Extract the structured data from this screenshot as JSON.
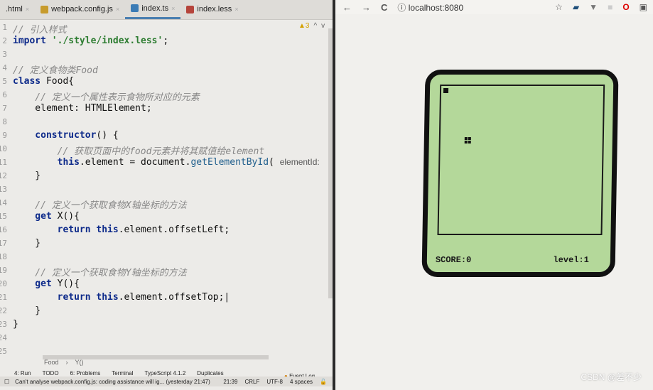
{
  "ide": {
    "tabs": [
      {
        "label": ".html",
        "active": false
      },
      {
        "label": "webpack.config.js",
        "active": false,
        "icon_color": "#c79b2c"
      },
      {
        "label": "index.ts",
        "active": true,
        "icon_color": "#3b7bb5"
      },
      {
        "label": "index.less",
        "active": false,
        "icon_color": "#b5443b"
      }
    ],
    "warnings": {
      "count": "3",
      "up": "^",
      "down": "v"
    },
    "lines": [
      [
        [
          "cm",
          "// 引入样式"
        ]
      ],
      [
        [
          "kw",
          "import "
        ],
        [
          "str",
          "'./style/index.less'"
        ],
        [
          "",
          "; "
        ]
      ],
      [],
      [
        [
          "cm",
          "// 定义食物类Food"
        ]
      ],
      [
        [
          "kw",
          "class "
        ],
        [
          "",
          "Food{"
        ]
      ],
      [
        [
          "cm",
          "    // 定义一个属性表示食物所对应的元素"
        ]
      ],
      [
        [
          "",
          "    element: HTMLElement;"
        ]
      ],
      [],
      [
        [
          "kw",
          "    constructor"
        ],
        [
          "",
          "() {"
        ]
      ],
      [
        [
          "cm",
          "        // 获取页面中的food元素并将其赋值给element"
        ]
      ],
      [
        [
          "kw",
          "        this"
        ],
        [
          "",
          ".element = document."
        ],
        [
          "fn",
          "getElementById"
        ],
        [
          "",
          "( "
        ],
        [
          "hint",
          "elementId:"
        ]
      ],
      [
        [
          "",
          "    }"
        ]
      ],
      [],
      [
        [
          "cm",
          "    // 定义一个获取食物X轴坐标的方法"
        ]
      ],
      [
        [
          "kw",
          "    get "
        ],
        [
          "",
          "X(){"
        ]
      ],
      [
        [
          "kw",
          "        return this"
        ],
        [
          "",
          ".element.offsetLeft;"
        ]
      ],
      [
        [
          "",
          "    }"
        ]
      ],
      [],
      [
        [
          "cm",
          "    // 定义一个获取食物Y轴坐标的方法"
        ]
      ],
      [
        [
          "kw",
          "    get "
        ],
        [
          "",
          "Y(){"
        ]
      ],
      [
        [
          "kw",
          "        return this"
        ],
        [
          "",
          ".element.offsetTop;|"
        ]
      ],
      [
        [
          "",
          "    }"
        ]
      ],
      [
        [
          "",
          "}"
        ]
      ],
      [],
      []
    ],
    "breadcrumb": [
      "Food",
      "Y()"
    ],
    "toolwindows": [
      "4: Run",
      "TODO",
      "6: Problems",
      "Terminal",
      "TypeScript 4.1.2",
      "Duplicates"
    ],
    "event_log": "Event Log",
    "status": {
      "message": "Can't analyse webpack.config.js: coding assistance will ig... (yesterday 21:47)",
      "position": "21:39",
      "line_ending": "CRLF",
      "encoding": "UTF-8",
      "indent": "4 spaces"
    }
  },
  "browser": {
    "url": "localhost:8080",
    "back": "←",
    "forward": "→",
    "reload": "C",
    "info": "ⓘ",
    "star": "☆"
  },
  "game": {
    "score_label": "SCORE:0",
    "level_label": "level:1",
    "bg_color": "#b4d89a"
  },
  "watermark": "CSDN @差不少"
}
